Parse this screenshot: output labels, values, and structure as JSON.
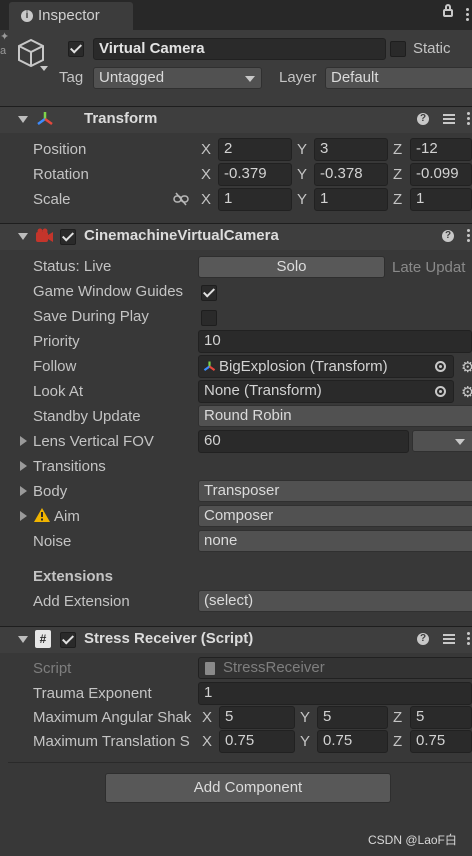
{
  "tab": {
    "title": "Inspector",
    "icon": "info-icon"
  },
  "object": {
    "active": true,
    "name": "Virtual Camera",
    "static_label": "Static",
    "static": false,
    "tag_label": "Tag",
    "tag_value": "Untagged",
    "layer_label": "Layer",
    "layer_value": "Default"
  },
  "transform": {
    "title": "Transform",
    "rows": [
      {
        "label": "Position",
        "x": "2",
        "y": "3",
        "z": "-12"
      },
      {
        "label": "Rotation",
        "x": "-0.379",
        "y": "-0.378",
        "z": "-0.099"
      },
      {
        "label": "Scale",
        "x": "1",
        "y": "1",
        "z": "1"
      }
    ],
    "axis": {
      "x": "X",
      "y": "Y",
      "z": "Z"
    }
  },
  "vcam": {
    "enabled": true,
    "title": "CinemachineVirtualCamera",
    "status_label": "Status: Live",
    "solo_label": "Solo",
    "late_update_label": "Late Updat",
    "game_window_guides_label": "Game Window Guides",
    "game_window_guides": true,
    "save_during_play_label": "Save During Play",
    "save_during_play": false,
    "priority_label": "Priority",
    "priority_value": "10",
    "follow_label": "Follow",
    "follow_value": "BigExplosion (Transform)",
    "look_at_label": "Look At",
    "look_at_value": "None (Transform)",
    "standby_label": "Standby Update",
    "standby_value": "Round Robin",
    "lens_label": "Lens Vertical FOV",
    "lens_value": "60",
    "transitions_label": "Transitions",
    "body_label": "Body",
    "body_value": "Transposer",
    "aim_label": "Aim",
    "aim_value": "Composer",
    "noise_label": "Noise",
    "noise_value": "none",
    "extensions_label": "Extensions",
    "add_extension_label": "Add Extension",
    "add_extension_value": "(select)"
  },
  "stress": {
    "enabled": true,
    "title": "Stress Receiver (Script)",
    "script_label": "Script",
    "script_value": "StressReceiver",
    "trauma_label": "Trauma Exponent",
    "trauma_value": "1",
    "max_ang_label": "Maximum Angular Shak",
    "max_ang": {
      "x": "5",
      "y": "5",
      "z": "5"
    },
    "max_trans_label": "Maximum Translation S",
    "max_trans": {
      "x": "0.75",
      "y": "0.75",
      "z": "0.75"
    }
  },
  "add_component_label": "Add Component",
  "watermark": "CSDN @LaoF白",
  "colors": {
    "panel": "#383838",
    "field": "#2a2a2a",
    "header": "#3e3e3e",
    "button": "#585858"
  }
}
